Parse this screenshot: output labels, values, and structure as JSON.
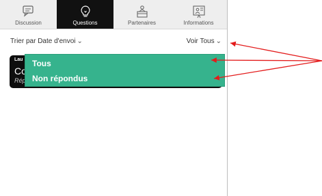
{
  "tabs": [
    {
      "label": "Discussion",
      "icon": "chat-icon",
      "active": false
    },
    {
      "label": "Questions",
      "icon": "lightbulb-icon",
      "active": true
    },
    {
      "label": "Partenaires",
      "icon": "presenter-icon",
      "active": false
    },
    {
      "label": "Informations",
      "icon": "info-board-icon",
      "active": false
    }
  ],
  "sortbar": {
    "sort_prefix": "Trier par",
    "sort_value": "Date d'envoi",
    "view_prefix": "Voir",
    "view_value": "Tous"
  },
  "question_card": {
    "author": "Lau",
    "text": "Co",
    "reply_label": "Répondre"
  },
  "dropdown": {
    "options": [
      "Tous",
      "Non répondus"
    ]
  },
  "colors": {
    "active_tab": "#111111",
    "dropdown_bg": "#36b38d",
    "annotation_red": "#e31b1b"
  }
}
